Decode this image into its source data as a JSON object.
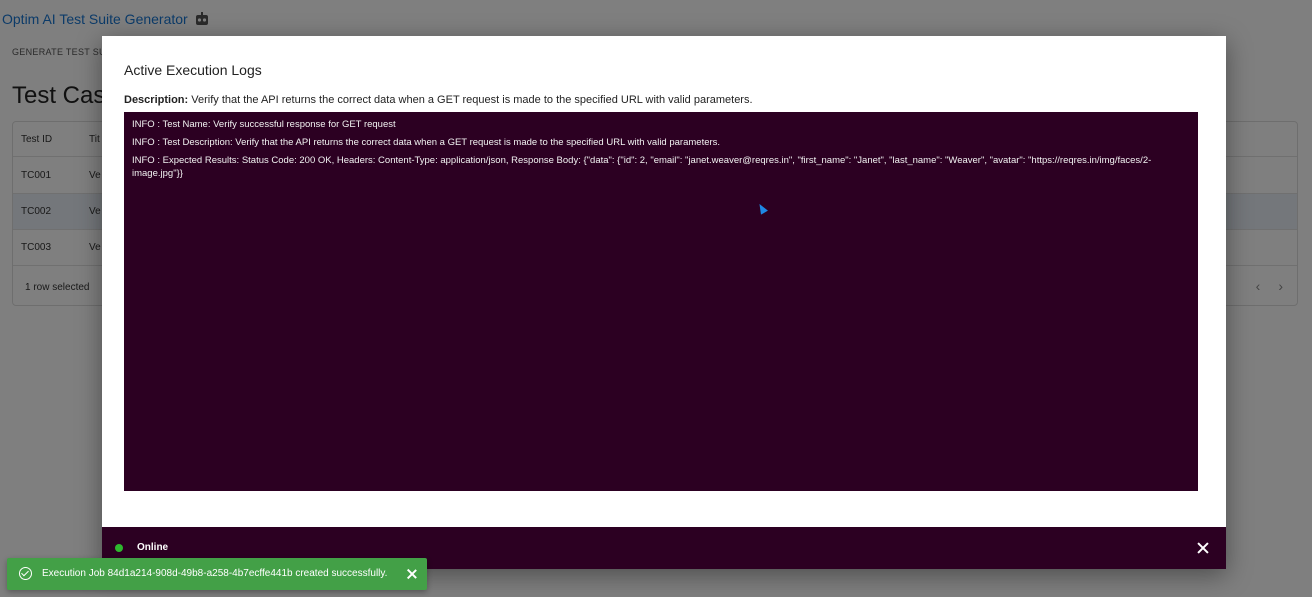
{
  "app": {
    "title": "Optim AI Test Suite Generator",
    "tab_label": "GENERATE TEST SU",
    "heading": "Test Cas"
  },
  "table": {
    "columns": [
      "Test ID",
      "Tit"
    ],
    "rows": [
      {
        "id": "TC001",
        "title": "Ve"
      },
      {
        "id": "TC002",
        "title": "Ve"
      },
      {
        "id": "TC003",
        "title": "Ve"
      }
    ],
    "footer_selected": "1 row selected",
    "pager_prev": "‹",
    "pager_next": "›"
  },
  "modal": {
    "title": "Active Execution Logs",
    "description_label": "Description:",
    "description_text": "Verify that the API returns the correct data when a GET request is made to the specified URL with valid parameters.",
    "logs": [
      "INFO : Test Name: Verify successful response for GET request",
      "INFO : Test Description: Verify that the API returns the correct data when a GET request is made to the specified URL with valid parameters.",
      "INFO : Expected Results: Status Code: 200 OK, Headers: Content-Type: application/json, Response Body: {\"data\": {\"id\": 2, \"email\": \"janet.weaver@reqres.in\", \"first_name\": \"Janet\", \"last_name\": \"Weaver\", \"avatar\": \"https://reqres.in/img/faces/2-image.jpg\"}}"
    ],
    "status_label": "Online",
    "status_color": "#2eb82e",
    "terminal_bg": "#2c0022"
  },
  "toast": {
    "message": "Execution Job 84d1a214-908d-49b8-a258-4b7ecffe441b created successfully.",
    "color": "#43a047"
  }
}
